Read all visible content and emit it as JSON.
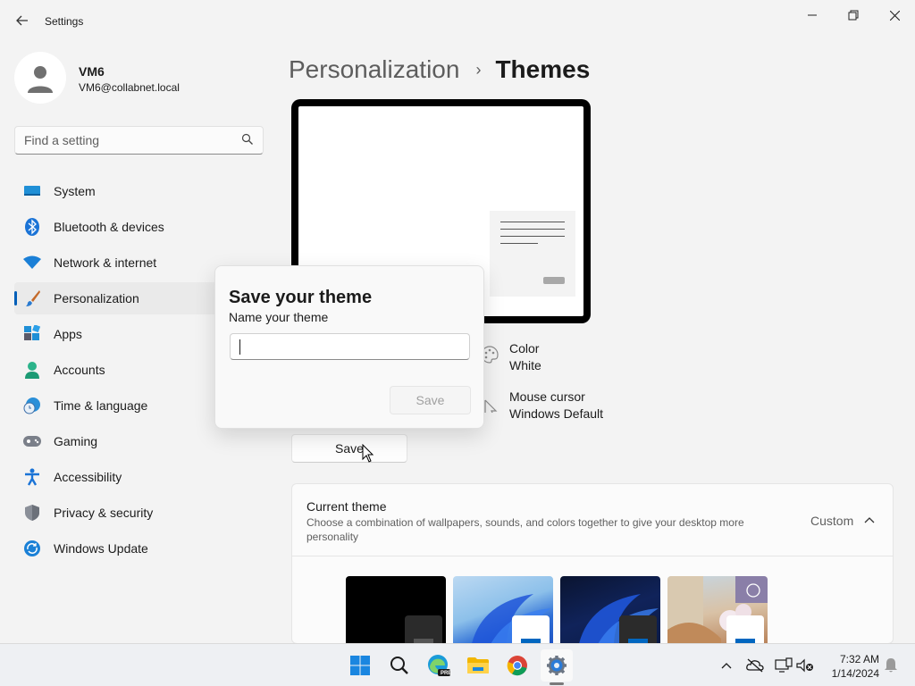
{
  "window": {
    "title": "Settings",
    "back": "back-arrow-icon",
    "controls": [
      "minimize-icon",
      "maximize-icon",
      "close-icon"
    ]
  },
  "user": {
    "name": "VM6",
    "email": "VM6@collabnet.local"
  },
  "search": {
    "placeholder": "Find a setting"
  },
  "sidebar": {
    "items": [
      {
        "label": "System",
        "icon": "system-icon"
      },
      {
        "label": "Bluetooth & devices",
        "icon": "bluetooth-icon"
      },
      {
        "label": "Network & internet",
        "icon": "wifi-icon"
      },
      {
        "label": "Personalization",
        "icon": "brush-icon",
        "selected": true
      },
      {
        "label": "Apps",
        "icon": "apps-icon"
      },
      {
        "label": "Accounts",
        "icon": "accounts-icon"
      },
      {
        "label": "Time & language",
        "icon": "globe-clock-icon"
      },
      {
        "label": "Gaming",
        "icon": "gamepad-icon"
      },
      {
        "label": "Accessibility",
        "icon": "accessibility-icon"
      },
      {
        "label": "Privacy & security",
        "icon": "shield-icon"
      },
      {
        "label": "Windows Update",
        "icon": "update-icon"
      }
    ]
  },
  "breadcrumb": {
    "parent": "Personalization",
    "separator": "›",
    "current": "Themes"
  },
  "theme_props": {
    "color": {
      "title": "Color",
      "value": "White"
    },
    "cursor": {
      "title": "Mouse cursor",
      "value": "Windows Default"
    }
  },
  "save_label": "Save",
  "current_theme": {
    "title": "Current theme",
    "description": "Choose a combination of wallpapers, sounds, and colors together to give your desktop more personality",
    "value": "Custom"
  },
  "dialog": {
    "title": "Save your theme",
    "label": "Name your theme",
    "input_value": "",
    "save_label": "Save"
  },
  "taskbar": {
    "apps": [
      "windows-start-icon",
      "search-icon",
      "edge-preview-icon",
      "file-explorer-icon",
      "chrome-icon",
      "settings-icon"
    ],
    "edge_badge": "PRE",
    "time": "7:32 AM",
    "date": "1/14/2024"
  },
  "colors": {
    "accent": "#005fb8",
    "background": "#f3f3f3"
  }
}
